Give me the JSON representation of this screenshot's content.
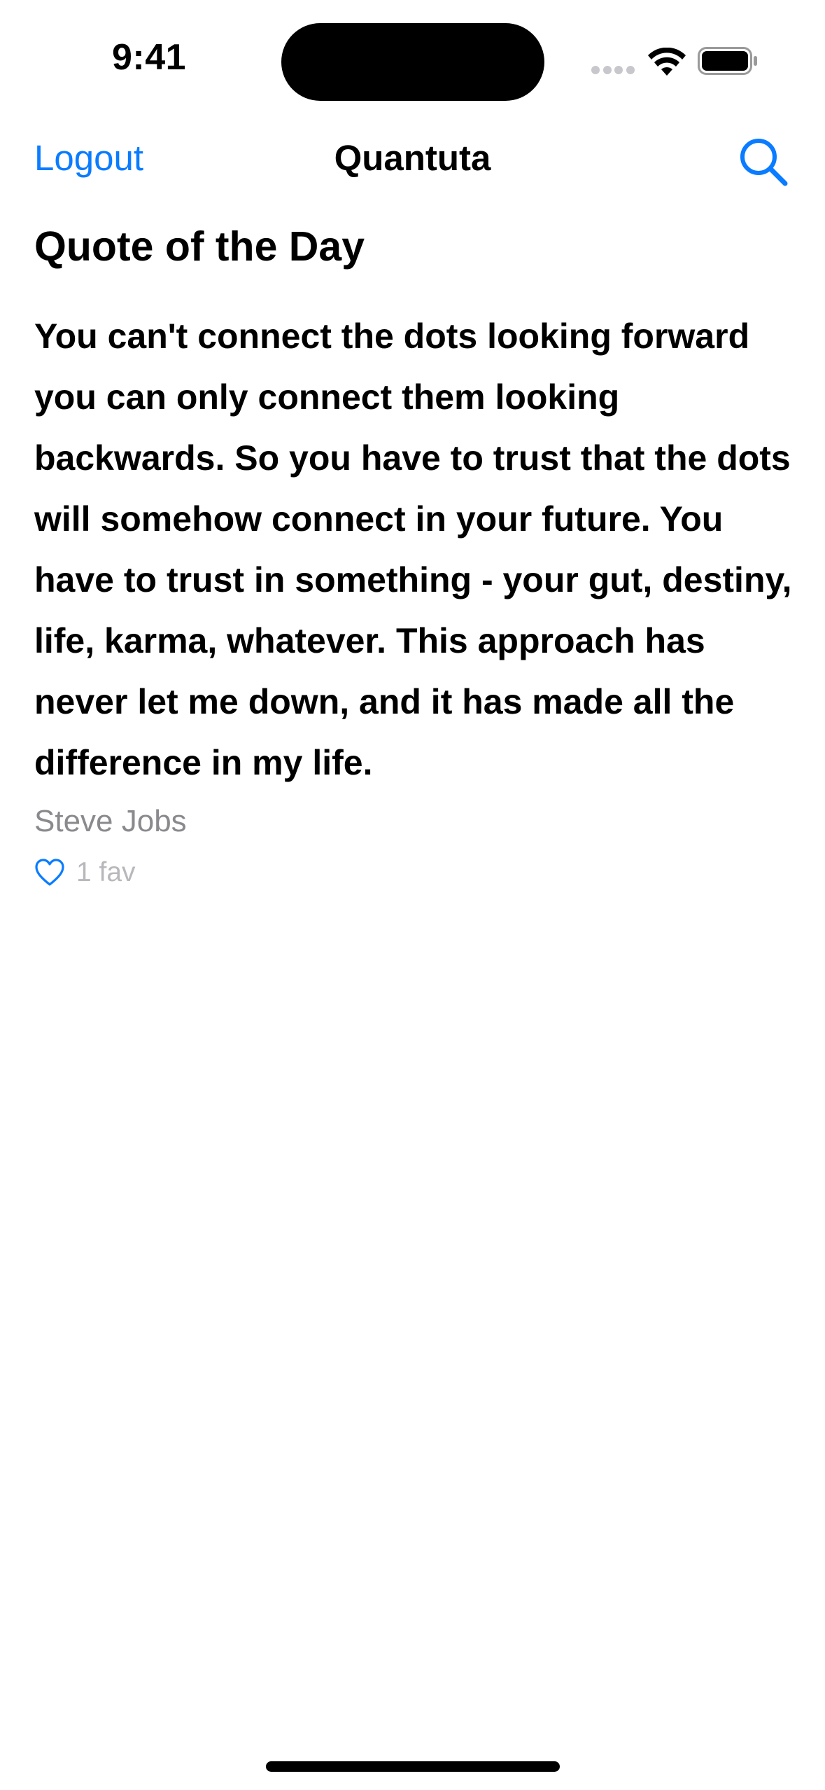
{
  "status_bar": {
    "time": "9:41",
    "icons": [
      "signal-icon",
      "wifi-icon",
      "battery-icon"
    ]
  },
  "nav": {
    "left_label": "Logout",
    "title": "Quantuta",
    "right_icon": "search-icon"
  },
  "content": {
    "section_title": "Quote of the Day",
    "quote": "You can't connect the dots looking forward you can only connect them looking backwards. So you have to trust that the dots will somehow connect in your future. You have to trust in something - your gut, destiny, life, karma, whatever. This approach has never let me down, and it has made all the difference in my life.",
    "author": "Steve Jobs",
    "fav_icon": "heart-icon",
    "fav_label": "1 fav"
  },
  "colors": {
    "accent": "#0a7cff",
    "secondary_text": "#8a8a8e",
    "tertiary_text": "#b8b8bc"
  }
}
